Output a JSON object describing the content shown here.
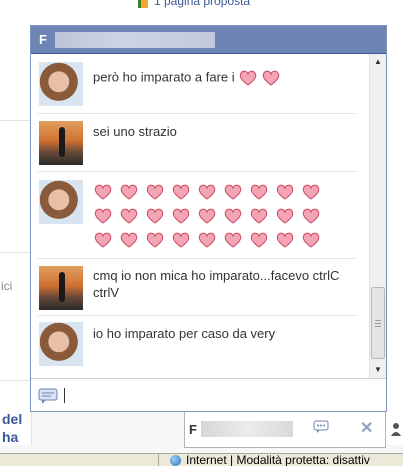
{
  "background": {
    "top_link": "1 pagina proposta",
    "left_fragment": "ici",
    "left_bottom_fragment_1": "del",
    "left_bottom_fragment_2": "ha"
  },
  "chat": {
    "header_initial": "F",
    "messages": [
      {
        "avatar": "avatar-photo-woman",
        "text": "però ho imparato a fare i",
        "trailing_hearts": 2
      },
      {
        "avatar": "avatar-photo-silhouette",
        "text": "sei uno strazio",
        "trailing_hearts": 0
      },
      {
        "avatar": "avatar-photo-woman",
        "text": "",
        "heart_rows": [
          9,
          9,
          9
        ]
      },
      {
        "avatar": "avatar-photo-silhouette",
        "text": "cmq io non mica ho imparato...facevo ctrlC ctrlV",
        "trailing_hearts": 0
      },
      {
        "avatar": "avatar-photo-woman",
        "text": "io ho imparato per caso da very",
        "trailing_hearts": 0
      }
    ],
    "input_value": ""
  },
  "tab": {
    "name_initial": "F",
    "close_label": "✕"
  },
  "statusbar": {
    "text": "Internet | Modalità protetta: disattiv"
  },
  "colors": {
    "header_bg": "#6d84b4",
    "heart_fill": "#f4a5b5",
    "heart_stroke": "#c8485f",
    "link": "#3b5998"
  }
}
